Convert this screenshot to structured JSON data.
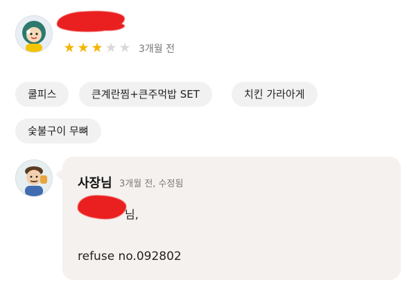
{
  "review": {
    "reviewer_name": "",
    "rating": 3,
    "max_rating": 5,
    "time_ago": "3개월 전",
    "colors": {
      "star_filled": "#f4b400",
      "star_empty": "#d9d9d9",
      "redaction": "#ea1f1f"
    }
  },
  "tags": [
    "쿨피스",
    "큰계란찜+큰주먹밥 SET",
    "치킨 가라아게",
    "숯불구이 무뼈"
  ],
  "owner_reply": {
    "author": "사장님",
    "meta": "3개월 전, 수정됨",
    "greeting_suffix": "님,",
    "body": "refuse no.092802",
    "bubble_color": "#f4f1ee"
  },
  "icons": [
    "reviewer-avatar-icon",
    "owner-avatar-icon",
    "star-icon"
  ]
}
